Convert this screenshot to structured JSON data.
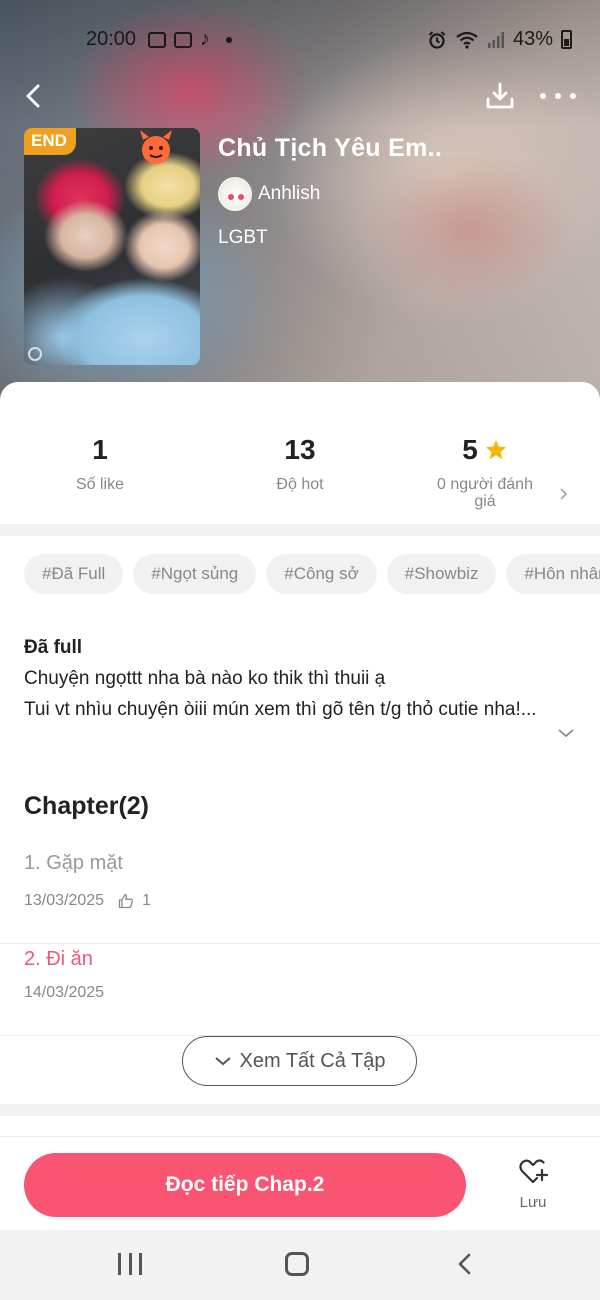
{
  "status_bar": {
    "time": "20:00",
    "battery": "43%"
  },
  "story": {
    "badge": "END",
    "title": "Chủ Tịch Yêu Em..",
    "author": "Anhlish",
    "genre": "LGBT"
  },
  "stats": {
    "likes": {
      "value": "1",
      "label": "Số like"
    },
    "hot": {
      "value": "13",
      "label": "Độ hot"
    },
    "rating": {
      "value": "5",
      "label": "0 người đánh giá"
    }
  },
  "tags": [
    "#Đã Full",
    "#Ngọt sủng",
    "#Công sở",
    "#Showbiz",
    "#Hôn nhân"
  ],
  "description": {
    "title": "Đã full",
    "line1": "Chuyện ngọttt nha bà nào ko thik thì thuii ạ",
    "line2": "Tui vt nhìu chuyện òiii mún xem thì gõ tên t/g thỏ cutie nha!..."
  },
  "chapters": {
    "heading": "Chapter(2)",
    "items": [
      {
        "title": "1. Gặp mặt",
        "date": "13/03/2025",
        "likes": "1",
        "color": "#999999"
      },
      {
        "title": "2. Đi ăn",
        "date": "14/03/2025",
        "color": "#f0557a"
      }
    ],
    "see_all_label": "Xem Tất Cả Tập"
  },
  "actions": {
    "read_label": "Đọc tiếp Chap.2",
    "save_label": "Lưu"
  },
  "colors": {
    "accent": "#fa5473",
    "end_badge": "#f0a020",
    "star": "#f5b50a"
  },
  "icons": [
    "back-icon",
    "download-icon",
    "more-icon",
    "star-icon",
    "chevron-right-icon",
    "chevron-down-icon",
    "thumb-up-icon",
    "heart-plus-icon"
  ]
}
